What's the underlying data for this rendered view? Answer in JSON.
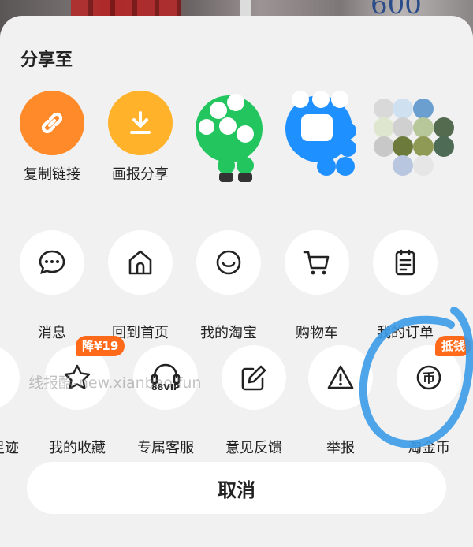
{
  "background": {
    "price_text": "600"
  },
  "sheet": {
    "title": "分享至",
    "share_targets": [
      {
        "label": "复制链接",
        "icon": "link-icon",
        "color": "#ff8a2a"
      },
      {
        "label": "画报分享",
        "icon": "download-icon",
        "color": "#ffb22a"
      },
      {
        "label": "",
        "icon": "wechat-app-icon-pixelated"
      },
      {
        "label": "",
        "icon": "qq-app-icon-pixelated"
      },
      {
        "label": "",
        "icon": "app-icon-pixelated"
      }
    ],
    "functions": [
      {
        "label": "消息",
        "icon": "chat-bubble-icon"
      },
      {
        "label": "回到首页",
        "icon": "home-icon"
      },
      {
        "label": "我的淘宝",
        "icon": "smile-icon"
      },
      {
        "label": "购物车",
        "icon": "cart-icon"
      },
      {
        "label": "我的订单",
        "icon": "order-list-icon"
      }
    ],
    "more": [
      {
        "label": "足迹",
        "icon": "footprint-icon"
      },
      {
        "label": "我的收藏",
        "icon": "star-icon",
        "badge": "降¥19"
      },
      {
        "label": "专属客服",
        "icon": "headset-88vip-icon",
        "icon_text": "88VIP"
      },
      {
        "label": "意见反馈",
        "icon": "edit-icon"
      },
      {
        "label": "举报",
        "icon": "warning-icon"
      },
      {
        "label": "淘金币",
        "icon": "coin-icon",
        "icon_text": "币",
        "badge": "抵钱"
      }
    ],
    "cancel_label": "取消",
    "watermark": "线报酷-new.xianbao.fun"
  },
  "colors": {
    "accent_orange": "#ff8a2a",
    "accent_yellow": "#ffb22a",
    "badge": "#ff6a1a",
    "annotation": "#3b9be8"
  }
}
